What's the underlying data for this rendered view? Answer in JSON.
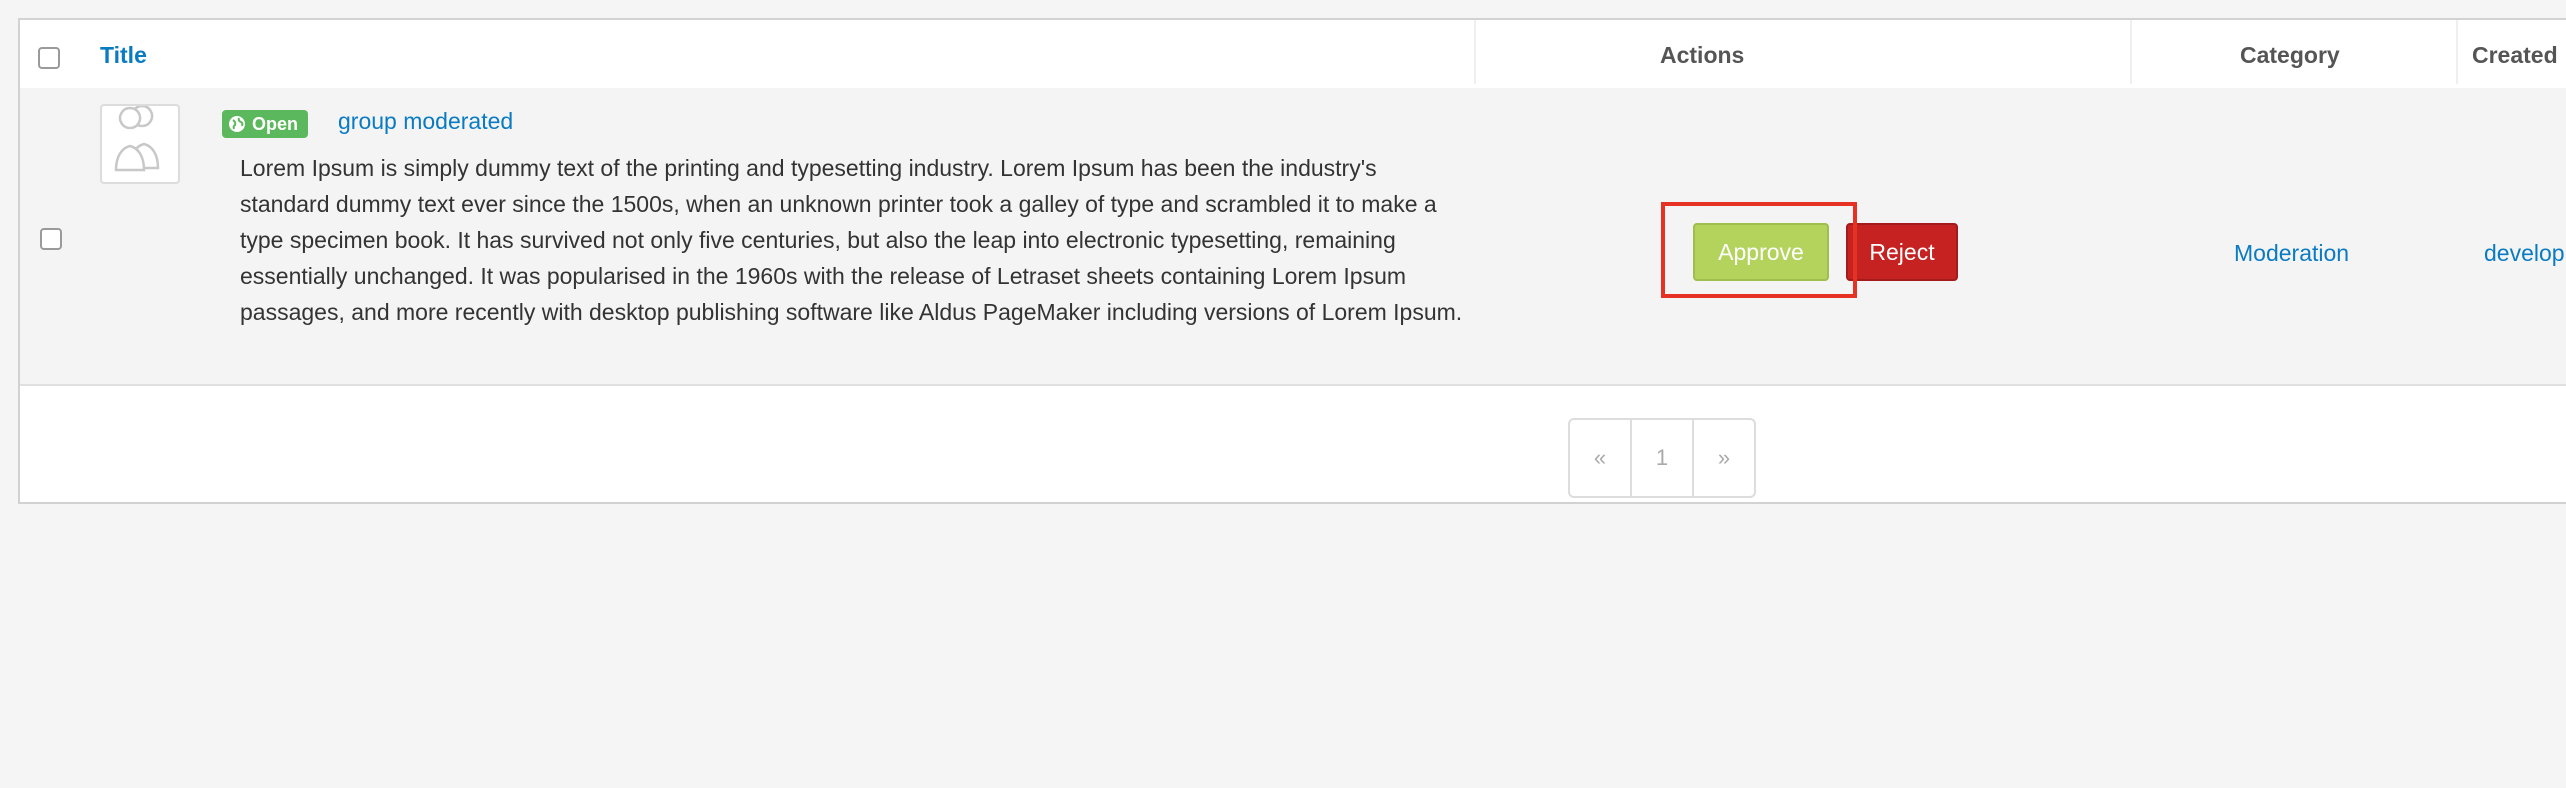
{
  "table": {
    "headers": {
      "title": "Title",
      "actions": "Actions",
      "category": "Category",
      "created": "Created"
    },
    "rows": [
      {
        "badge": "Open",
        "group_title": "group moderated",
        "description": "Lorem Ipsum is simply dummy text of the printing and typesetting industry. Lorem Ipsum has been the industry's standard dummy text ever since the 1500s, when an unknown printer took a galley of type and scrambled it to make a type specimen book. It has survived not only five centuries, but also the leap into electronic typesetting, remaining essentially unchanged. It was popularised in the 1960s with the release of Letraset sheets containing Lorem Ipsum passages, and more recently with desktop publishing software like Aldus PageMaker including versions of Lorem Ipsum.",
        "approve_label": "Approve",
        "reject_label": "Reject",
        "category": "Moderation",
        "created_by": "develop"
      }
    ]
  },
  "pagination": {
    "prev": "«",
    "page": "1",
    "next": "»"
  },
  "colors": {
    "link": "#0a7bc2",
    "badge_green": "#5cb85c",
    "approve": "#b3d35d",
    "reject": "#c62222",
    "highlight": "#e53222"
  },
  "icons": {
    "badge_icon": "globe-icon",
    "avatar_icon": "group-avatar-icon"
  }
}
